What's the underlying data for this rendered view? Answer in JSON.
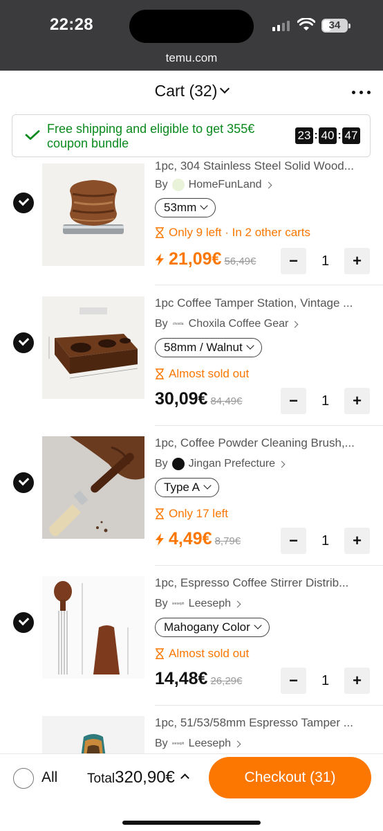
{
  "status_bar": {
    "time": "22:28",
    "battery": "34",
    "icons": [
      "signal-icon",
      "wifi-icon",
      "battery-icon"
    ]
  },
  "browser": {
    "url": "temu.com"
  },
  "header": {
    "title": "Cart (32)",
    "menu_icon": "more-icon"
  },
  "banner": {
    "text": "Free shipping and eligible to get 355€ coupon bundle",
    "timer": {
      "hours": "23",
      "minutes": "40",
      "seconds": "47"
    }
  },
  "items": [
    {
      "title": "1pc, 304 Stainless Steel Solid Wood...",
      "by": "By",
      "seller": "HomeFunLand",
      "variant": "53mm",
      "stock": "Only 9 left · In 2 other carts",
      "price": "21,09€",
      "old_price": "56,49€",
      "qty": "1",
      "lightning": true
    },
    {
      "title": "1pc Coffee Tamper Station, Vintage ...",
      "by": "By",
      "seller": "Choxila Coffee Gear",
      "seller_logo": "choxila",
      "variant": "58mm / Walnut",
      "stock": "Almost sold out",
      "price": "30,09€",
      "old_price": "84,49€",
      "qty": "1",
      "lightning": false
    },
    {
      "title": "1pc, Coffee Powder Cleaning Brush,...",
      "by": "By",
      "seller": "Jingan Prefecture",
      "variant": "Type A",
      "stock": "Only 17 left",
      "price": "4,49€",
      "old_price": "8,79€",
      "qty": "1",
      "lightning": true
    },
    {
      "title": "1pc, Espresso Coffee Stirrer Distrib...",
      "by": "By",
      "seller": "Leeseph",
      "seller_logo": "leeseph",
      "variant": "Mahogany Color",
      "stock": "Almost sold out",
      "price": "14,48€",
      "old_price": "26,29€",
      "qty": "1",
      "lightning": false
    },
    {
      "title": "1pc, 51/53/58mm Espresso Tamper ...",
      "by": "By",
      "seller": "Leeseph",
      "seller_logo": "leeseph"
    }
  ],
  "footer": {
    "all_label": "All",
    "total_label": "Total",
    "total_value": "320,90€",
    "checkout_label": "Checkout (31)"
  },
  "colors": {
    "accent": "#fb7701",
    "success": "#0a8a1d",
    "status_bar_bg": "#3b3b3d"
  }
}
